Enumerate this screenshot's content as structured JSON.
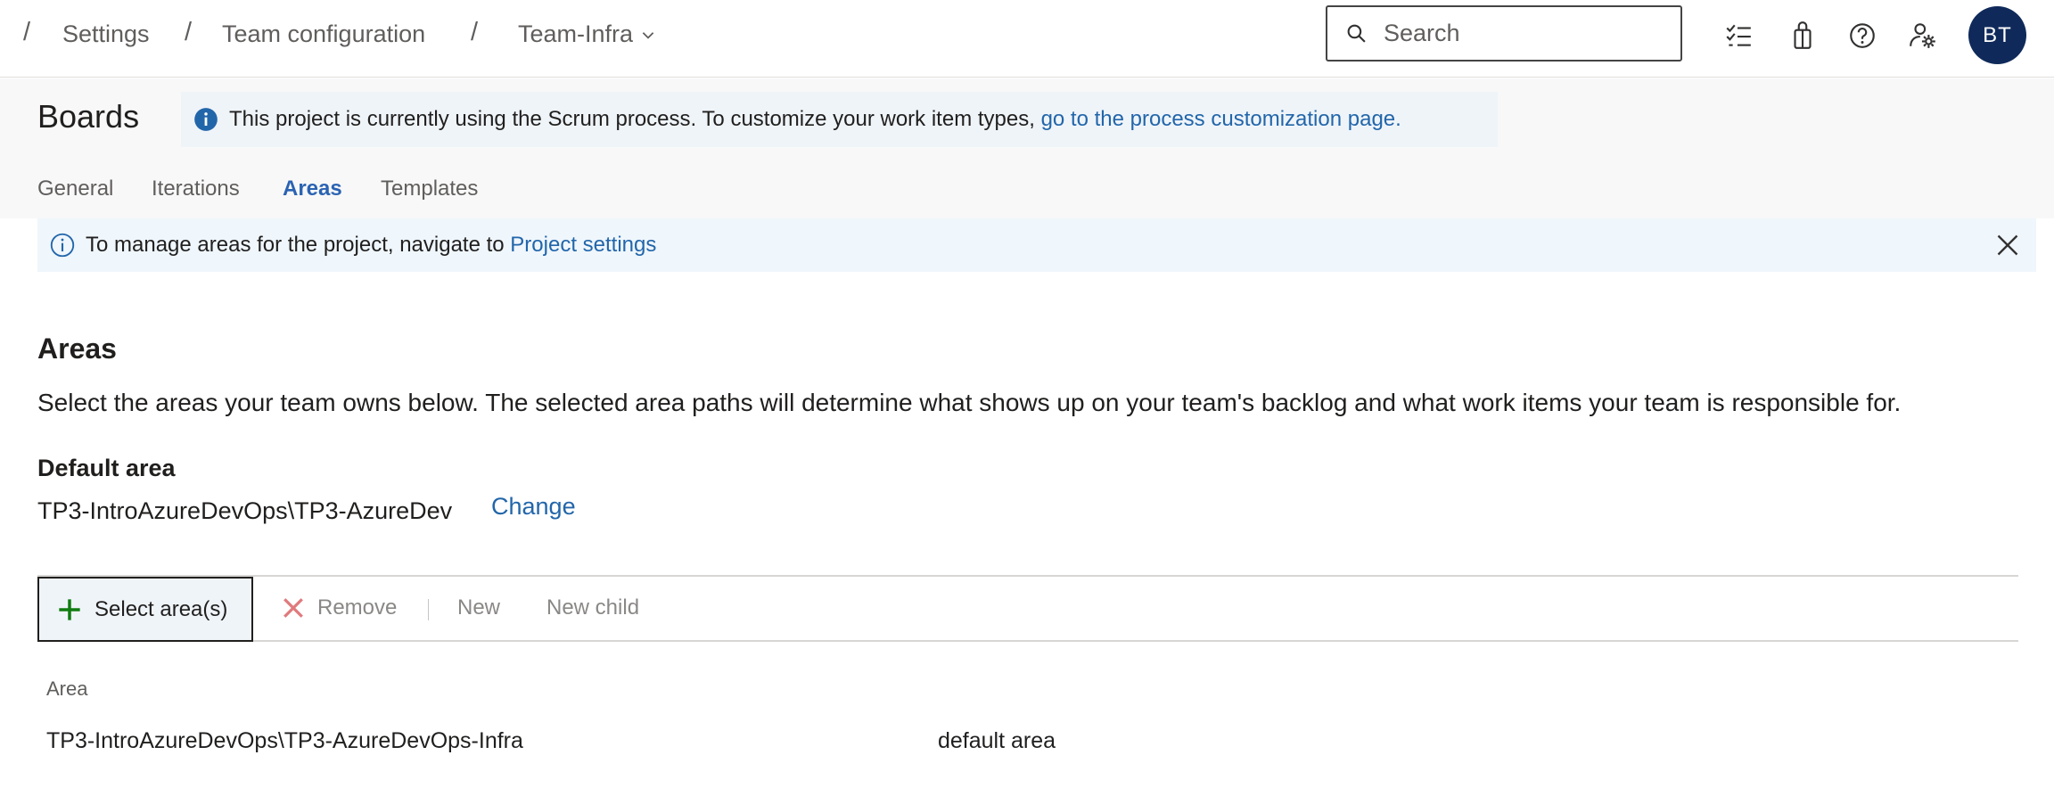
{
  "breadcrumb": {
    "items": [
      "Settings",
      "Team configuration",
      "Team-Infra"
    ],
    "separator": "/"
  },
  "search": {
    "placeholder": "Search",
    "icon": "search-icon"
  },
  "top_icons": [
    "checklist-icon",
    "shopping-bag-icon",
    "help-icon",
    "user-settings-icon"
  ],
  "user": {
    "initials": "BT",
    "avatar_color": "#0f2a5a"
  },
  "header": {
    "title": "Boards",
    "process_banner": {
      "text": "This project is currently using the Scrum process. To customize your work item types,",
      "link": "go to the process customization page."
    }
  },
  "tabs": [
    {
      "label": "General",
      "active": false
    },
    {
      "label": "Iterations",
      "active": false
    },
    {
      "label": "Areas",
      "active": true
    },
    {
      "label": "Templates",
      "active": false
    }
  ],
  "info_bar": {
    "text": "To manage areas for the project, navigate to",
    "link": "Project settings"
  },
  "areas": {
    "title": "Areas",
    "description": "Select the areas your team owns below. The selected area paths will determine what shows up on your team's backlog and what work items your team is responsible for.",
    "default_area_label": "Default area",
    "default_area_value": "TP3-IntroAzureDevOps\\TP3-AzureDev",
    "change_label": "Change"
  },
  "toolbar": {
    "select_areas": "Select area(s)",
    "remove": "Remove",
    "new": "New",
    "new_child": "New child"
  },
  "table": {
    "columns": [
      "Area"
    ],
    "rows": [
      {
        "area": "TP3-IntroAzureDevOps\\TP3-AzureDevOps-Infra",
        "note": "default area"
      }
    ]
  },
  "colors": {
    "accent": "#2b63b3",
    "link": "#2266aa",
    "add_green": "#107c10",
    "remove_red": "#d13438"
  }
}
